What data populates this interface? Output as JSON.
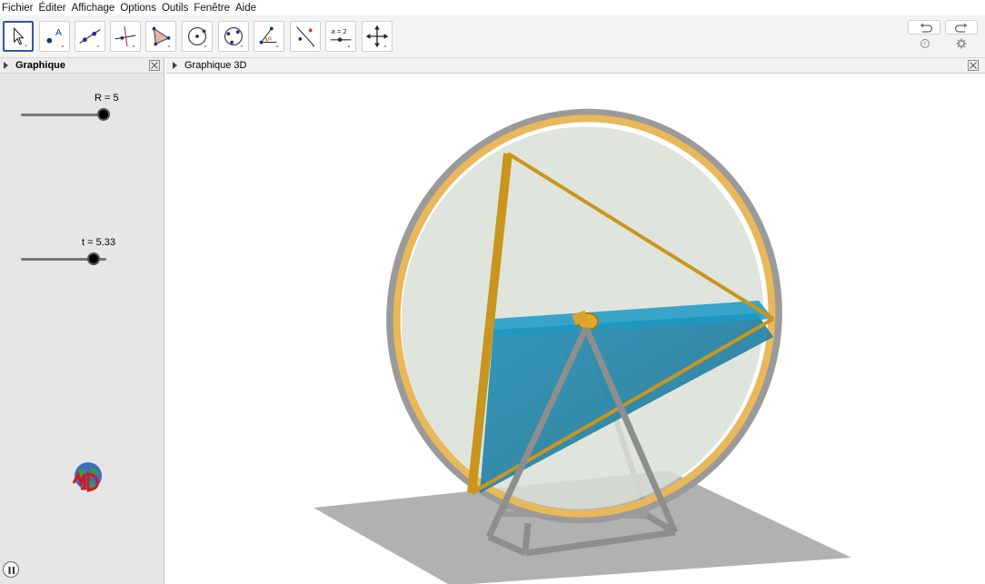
{
  "menu": [
    "Fichier",
    "Éditer",
    "Affichage",
    "Options",
    "Outils",
    "Fenêtre",
    "Aide"
  ],
  "toolbar": {
    "tools": [
      {
        "name": "move-tool-button",
        "icon": "arrow-cursor-icon",
        "active": true
      },
      {
        "name": "point-tool-button",
        "icon": "point-icon"
      },
      {
        "name": "line-tool-button",
        "icon": "line-icon"
      },
      {
        "name": "perpendicular-tool-button",
        "icon": "perpendicular-icon"
      },
      {
        "name": "polygon-tool-button",
        "icon": "polygon-icon"
      },
      {
        "name": "circle-tool-button",
        "icon": "circle-icon"
      },
      {
        "name": "conic-tool-button",
        "icon": "conic-icon"
      },
      {
        "name": "angle-tool-button",
        "icon": "angle-icon"
      },
      {
        "name": "reflect-tool-button",
        "icon": "reflect-icon"
      },
      {
        "name": "slider-tool-button",
        "icon": "slider-icon",
        "label": "a = 2"
      },
      {
        "name": "move-view-tool-button",
        "icon": "move-view-icon"
      }
    ],
    "undo_icon": "undo-icon",
    "redo_icon": "redo-icon",
    "help_icon": "help-icon",
    "settings_icon": "gear-icon"
  },
  "left_panel": {
    "title": "Graphique",
    "sliders": [
      {
        "label": "R = 5",
        "value": 5,
        "fraction": 0.95
      },
      {
        "label": "t = 5.33",
        "value": 5.33,
        "fraction": 0.85
      }
    ]
  },
  "right_panel": {
    "title": "Graphique 3D"
  },
  "colors": {
    "accent": "#2f57a8",
    "rim": "#e8b85a",
    "water": "#1e8fb3",
    "frame": "#9a9a9a",
    "ground": "#a8a8a8"
  }
}
